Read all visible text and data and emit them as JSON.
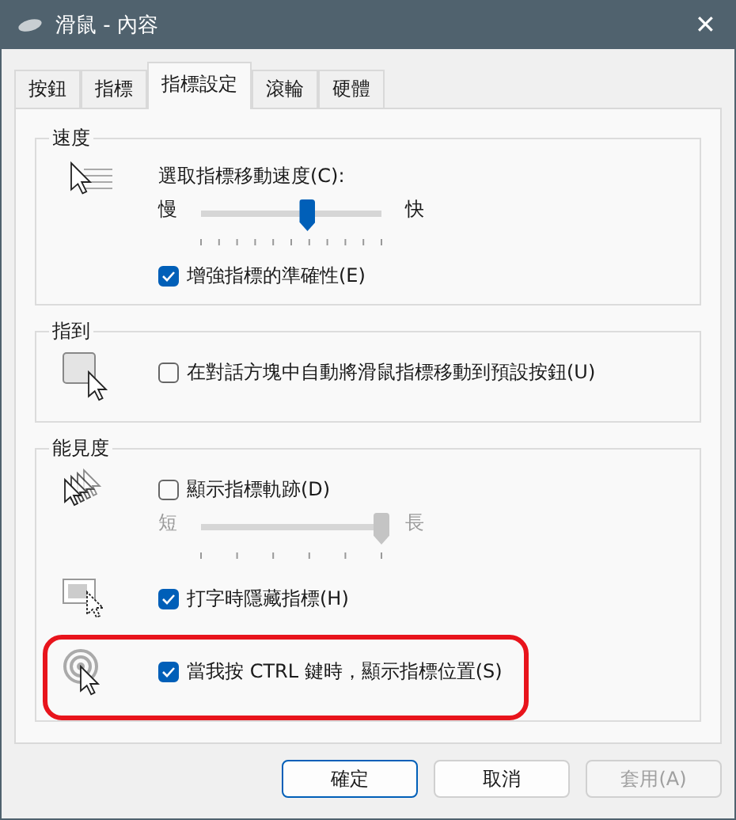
{
  "window": {
    "title": "滑鼠 - 內容",
    "close": "✕"
  },
  "tabs": [
    {
      "label": "按鈕",
      "selected": false
    },
    {
      "label": "指標",
      "selected": false
    },
    {
      "label": "指標設定",
      "selected": true
    },
    {
      "label": "滾輪",
      "selected": false
    },
    {
      "label": "硬體",
      "selected": false
    }
  ],
  "groups": [
    {
      "title": "速度",
      "items": [
        {
          "kind": "speed",
          "label": "選取指標移動速度(C):",
          "slider": {
            "min_label": "慢",
            "max_label": "快",
            "level": 0.59,
            "disabled": false
          }
        },
        {
          "kind": "checkbox",
          "label": "增強指標的準確性(E)",
          "checked": true
        }
      ]
    },
    {
      "title": "指到",
      "items": [
        {
          "kind": "checkbox",
          "label": "在對話方塊中自動將滑鼠指標移動到預設按鈕(U)",
          "checked": false
        }
      ]
    },
    {
      "title": "能見度",
      "items": [
        {
          "kind": "checkbox",
          "label": "顯示指標軌跡(D)",
          "checked": false,
          "slider": {
            "min_label": "短",
            "max_label": "長",
            "level": 1,
            "disabled": true
          }
        },
        {
          "kind": "checkbox",
          "label": "打字時隱藏指標(H)",
          "checked": true
        },
        {
          "kind": "checkbox",
          "label": "當我按 CTRL 鍵時，顯示指標位置(S)",
          "checked": true,
          "highlighted": true
        }
      ]
    }
  ],
  "buttons": [
    {
      "label": "確定",
      "default": true,
      "disabled": false
    },
    {
      "label": "取消",
      "default": false,
      "disabled": false
    },
    {
      "label": "套用(A)",
      "default": false,
      "disabled": true
    }
  ]
}
